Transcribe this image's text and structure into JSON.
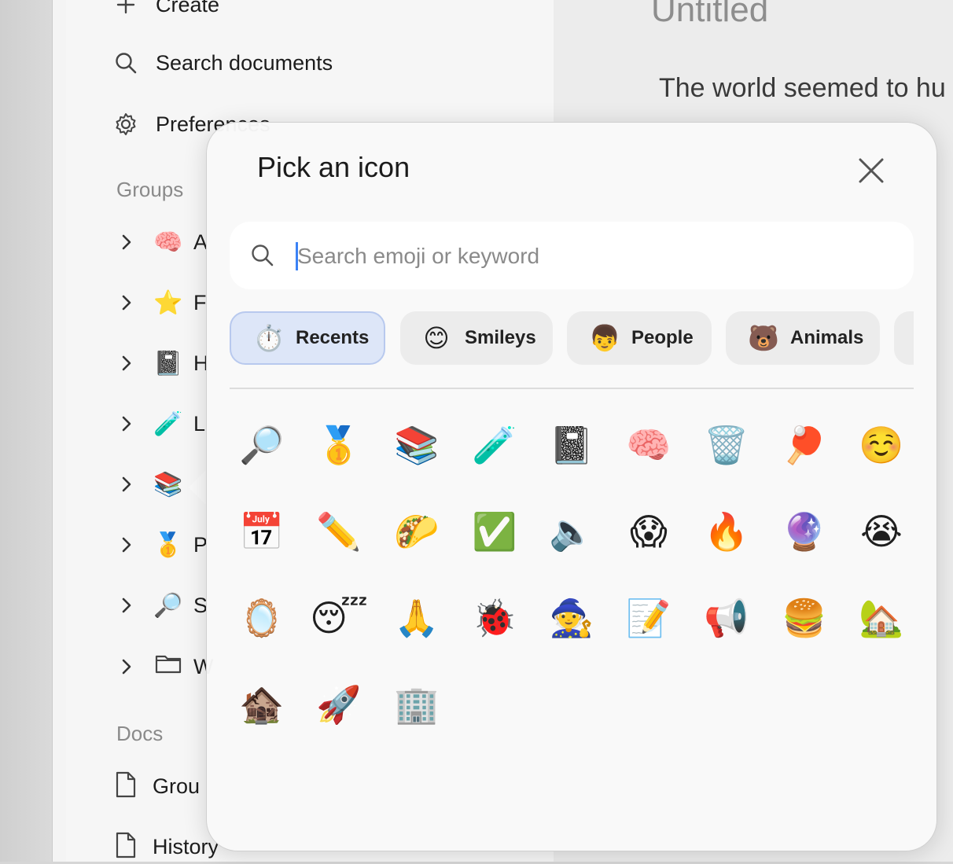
{
  "sidebar": {
    "nav": [
      {
        "label": "Create",
        "icon": "plus-icon"
      },
      {
        "label": "Search documents",
        "icon": "search-icon"
      },
      {
        "label": "Preferences",
        "icon": "gear-icon"
      }
    ],
    "groups_label": "Groups",
    "groups": [
      {
        "emoji": "🧠",
        "name": "A"
      },
      {
        "emoji": "⭐",
        "name": "F"
      },
      {
        "emoji": "📓",
        "name": "H"
      },
      {
        "emoji": "🧪",
        "name": "L"
      },
      {
        "emoji": "📚",
        "name": ""
      },
      {
        "emoji": "🥇",
        "name": "P"
      },
      {
        "emoji": "🔎",
        "name": "S"
      },
      {
        "emoji": "",
        "icon": "folder-icon",
        "name": "W"
      }
    ],
    "docs_label": "Docs",
    "docs": [
      {
        "name": "Grou",
        "icon": "document-icon"
      },
      {
        "name": "History",
        "icon": "document-icon"
      }
    ]
  },
  "editor": {
    "title": "Untitled",
    "body": "The world seemed to hu"
  },
  "picker": {
    "title": "Pick an icon",
    "search_placeholder": "Search emoji or keyword",
    "tabs": [
      {
        "emoji": "⏱️",
        "label": "Recents",
        "active": true
      },
      {
        "emoji": "😊",
        "label": "Smileys",
        "active": false
      },
      {
        "emoji": "👦",
        "label": "People",
        "active": false
      },
      {
        "emoji": "🐻",
        "label": "Animals",
        "active": false
      }
    ],
    "emojis": [
      [
        "🔎",
        "🥇",
        "📚",
        "🧪",
        "📓",
        "🧠",
        "🗑️",
        "🏓",
        "☺️"
      ],
      [
        "📅",
        "✏️",
        "🌮",
        "✅",
        "🔈",
        "😱",
        "🔥",
        "🔮",
        "😭"
      ],
      [
        "🪞",
        "😴",
        "🙏",
        "🐞",
        "🧙",
        "📝",
        "📢",
        "🍔",
        "🏡"
      ],
      [
        "🏚️",
        "🚀",
        "🏢"
      ]
    ]
  }
}
